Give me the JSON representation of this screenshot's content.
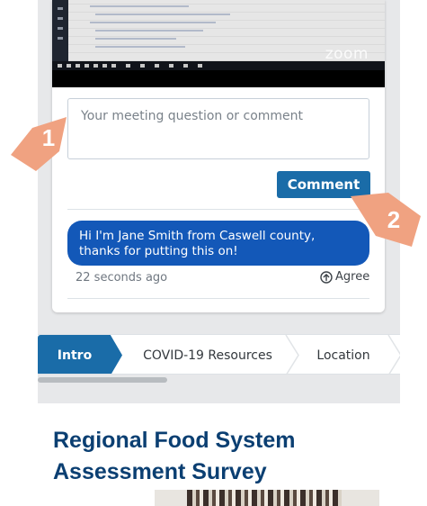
{
  "video": {
    "watermark": "zoom"
  },
  "comment_form": {
    "placeholder": "Your meeting question or comment",
    "submit_label": "Comment"
  },
  "comments": [
    {
      "text": "Hi I'm Jane Smith from Caswell county, thanks for putting this on!",
      "time": "22 seconds ago",
      "agree_label": "Agree",
      "agree_icon": "arrow-up-circle-icon"
    }
  ],
  "tabs": [
    {
      "label": "Intro",
      "active": true
    },
    {
      "label": "COVID-19 Resources",
      "active": false
    },
    {
      "label": "Location",
      "active": false
    }
  ],
  "survey": {
    "title": "Regional Food System Assessment Survey"
  },
  "callouts": [
    {
      "number": "1",
      "color": "#f0a281"
    },
    {
      "number": "2",
      "color": "#f0a281"
    }
  ],
  "colors": {
    "primary": "#1a6ca8",
    "bubble": "#1358b8",
    "title": "#0b3f72",
    "callout": "#f0a281"
  }
}
